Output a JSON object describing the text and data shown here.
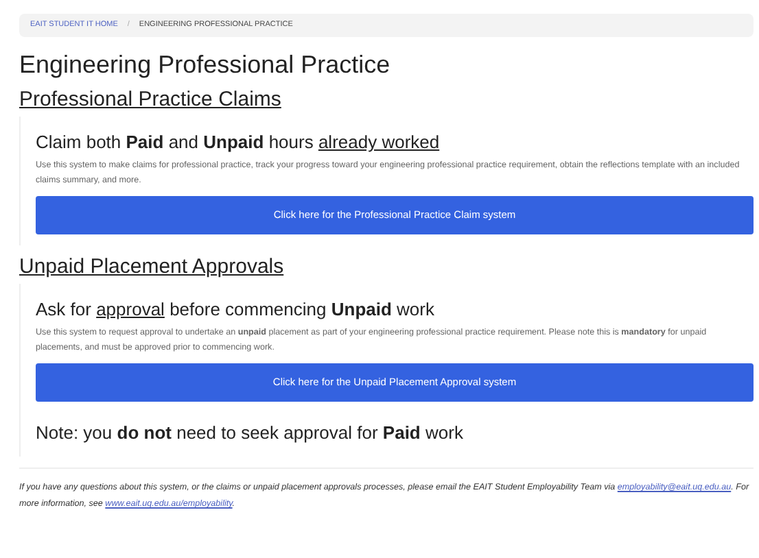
{
  "breadcrumb": [
    {
      "label": "EAIT STUDENT IT HOME",
      "kind": "link"
    },
    {
      "label": "/",
      "kind": "separator"
    },
    {
      "label": "ENGINEERING PROFESSIONAL PRACTICE",
      "kind": "current"
    }
  ],
  "title": "Engineering Professional Practice",
  "sections": [
    {
      "heading": "Professional Practice Claims",
      "subheading": [
        {
          "text": "Claim both **Paid** and **Unpaid** hours ",
          "underlined": false
        },
        {
          "text": "already worked",
          "underlined": true
        }
      ],
      "description": "Use this system to make claims for professional practice, track your progress toward your engineering professional practice requirement, obtain the reflections template with an included claims summary, and more.",
      "button": "Click here for the Professional Practice Claim system"
    },
    {
      "heading": "Unpaid Placement Approvals",
      "subheading": [
        {
          "text": "Ask for ",
          "underlined": false
        },
        {
          "text": "approval",
          "underlined": true
        },
        {
          "text": " before commencing **Unpaid** work",
          "underlined": false
        }
      ],
      "description": "Use this system to request approval to undertake an **unpaid** placement as part of your engineering professional practice requirement. Please note this is **mandatory** for unpaid placements, and must be approved prior to commencing work.",
      "button": "Click here for the Unpaid Placement Approval system",
      "note": "Note: you **do not** need to seek approval for **Paid** work"
    }
  ],
  "footer": [
    {
      "kind": "text",
      "text": "If you have any questions about this system, or the claims or unpaid placement approvals processes, please email the EAIT Student Employability Team via "
    },
    {
      "kind": "link",
      "text": "employability@eait.uq.edu.au"
    },
    {
      "kind": "text",
      "text": ". For more information, see "
    },
    {
      "kind": "link",
      "text": "www.eait.uq.edu.au/employability"
    },
    {
      "kind": "text",
      "text": "."
    }
  ]
}
